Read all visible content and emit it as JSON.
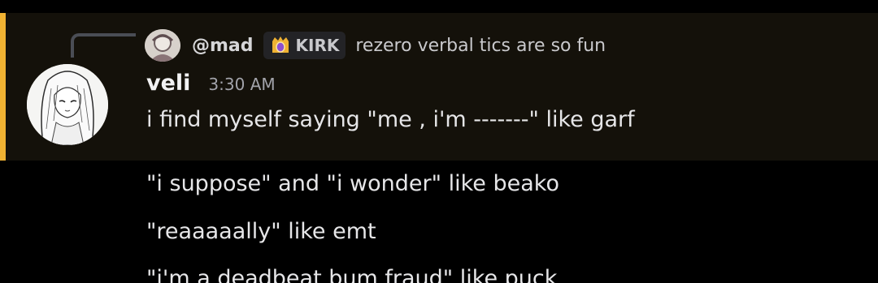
{
  "reply": {
    "author": "@mad",
    "role": "KIRK",
    "content": "rezero verbal tics are so fun",
    "avatar_icon": "avatar-image",
    "role_icon": "gem-icon"
  },
  "message": {
    "author": "veli",
    "timestamp": "3:30 AM",
    "avatar_icon": "avatar-image",
    "first_line": "i find myself saying \"me , i'm -------\" like garf"
  },
  "followups": [
    "\"i suppose\" and \"i wonder\" like beako",
    "\"reaaaaally\" like emt",
    "\"i'm a deadbeat bum fraud\" like puck"
  ],
  "colors": {
    "mention_bar": "#f0b232",
    "mention_bg": "#14110a",
    "background": "#000000",
    "timestamp": "#a2a3aa"
  }
}
